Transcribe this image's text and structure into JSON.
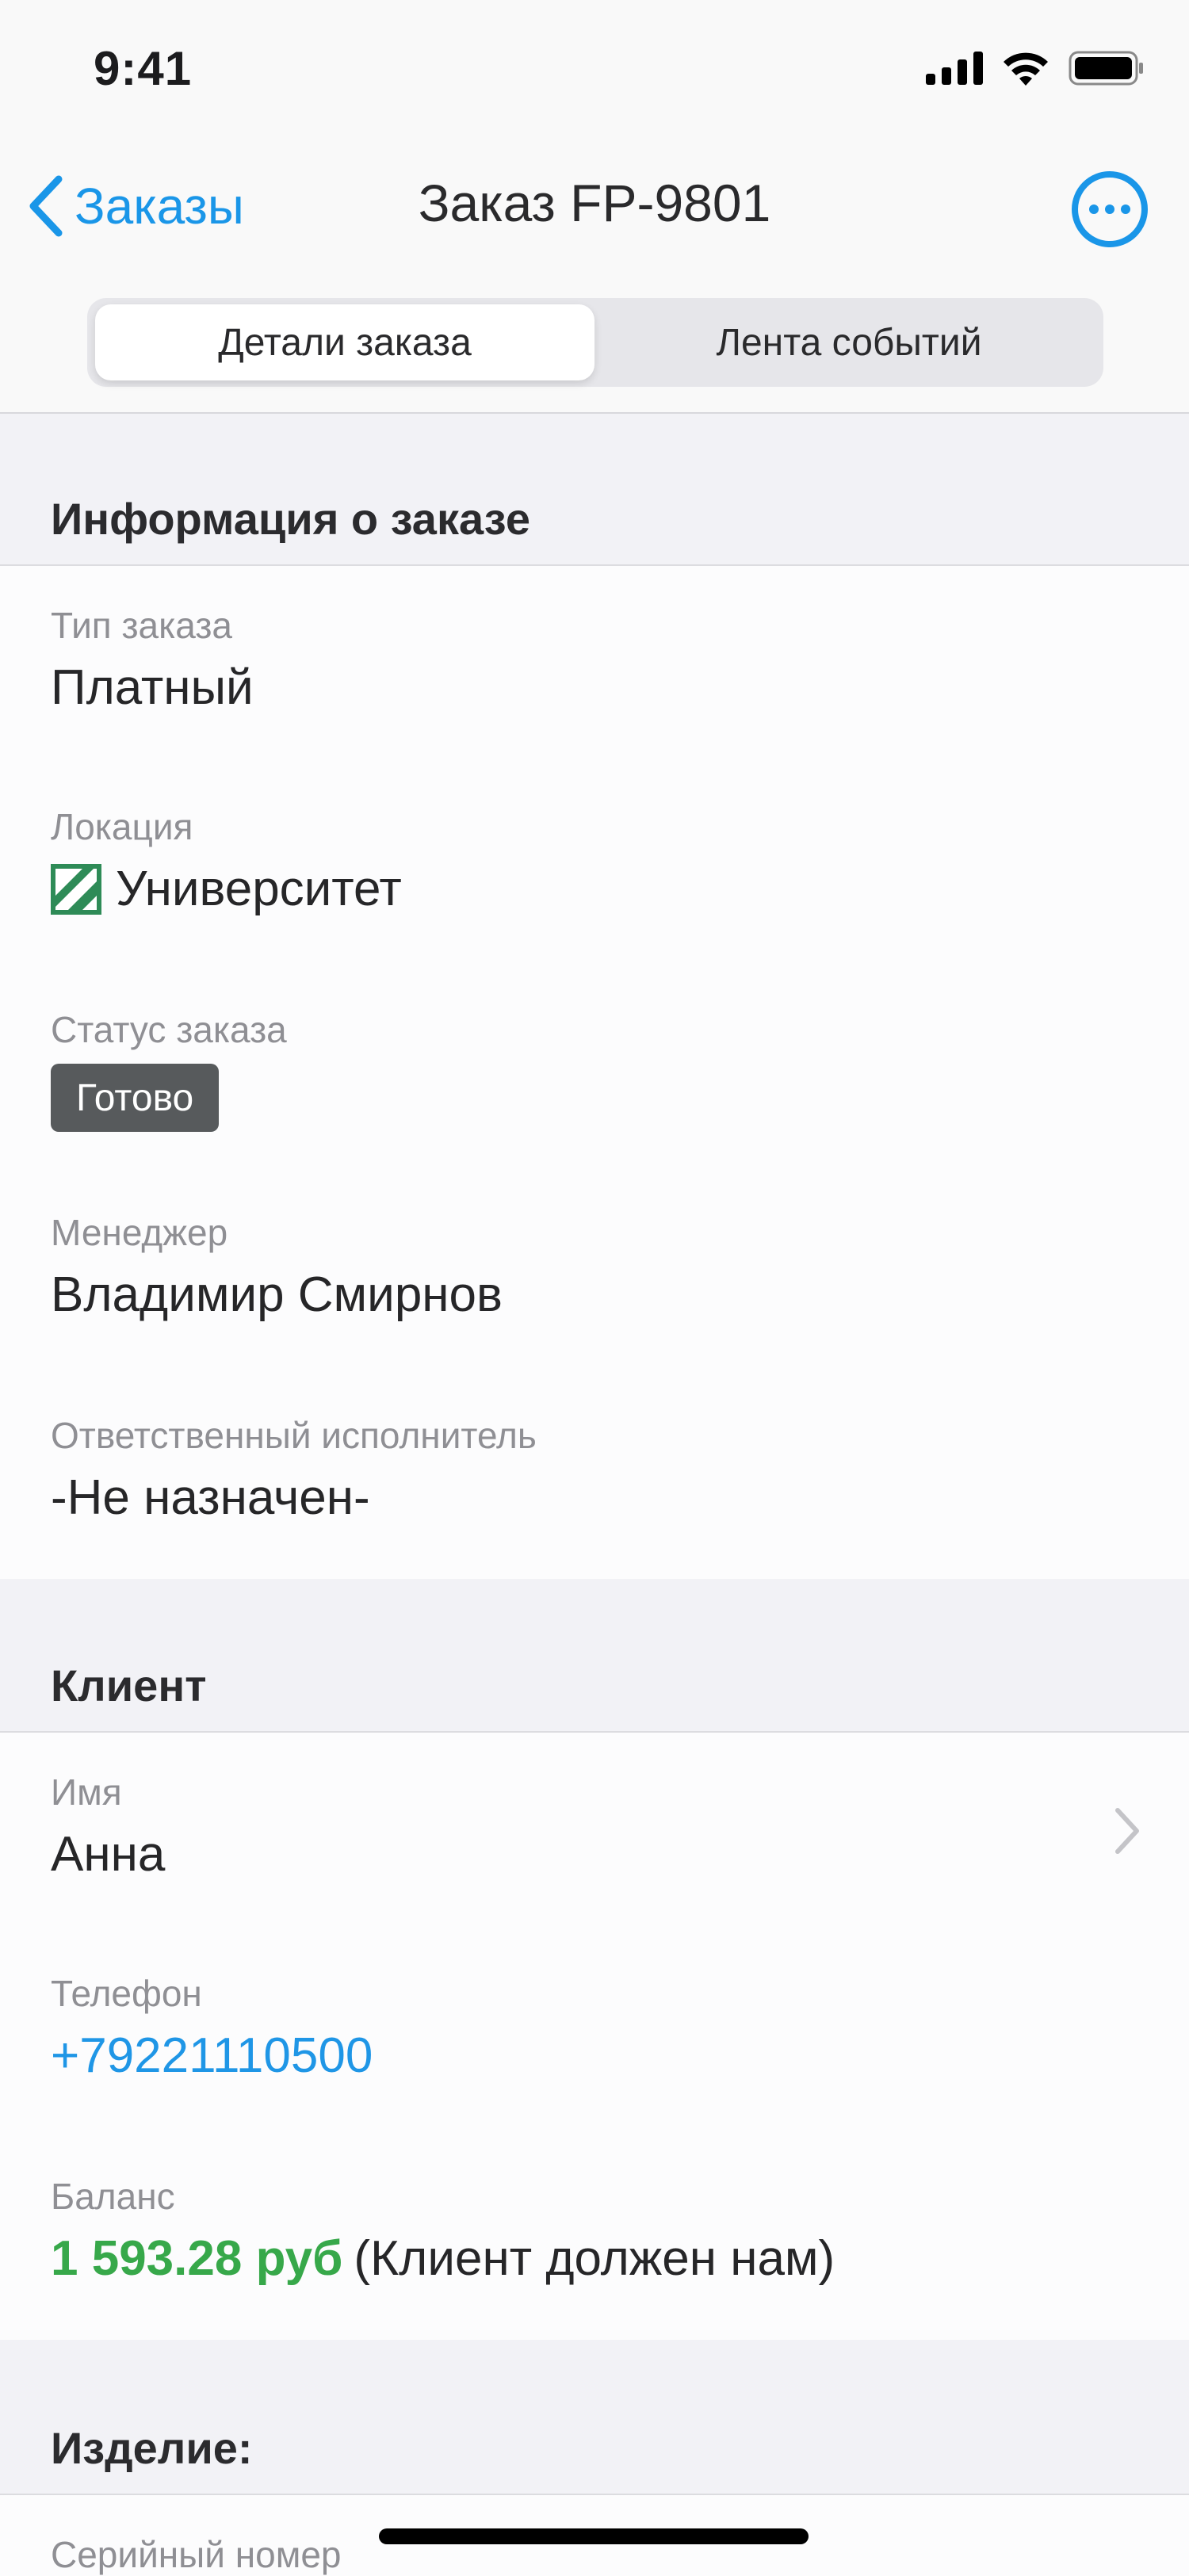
{
  "status_bar": {
    "time": "9:41"
  },
  "nav": {
    "back_label": "Заказы",
    "title": "Заказ FP-9801"
  },
  "tabs": {
    "details": "Детали заказа",
    "feed": "Лента событий"
  },
  "order_info": {
    "header": "Информация о заказе",
    "type_label": "Тип заказа",
    "type_value": "Платный",
    "location_label": "Локация",
    "location_value": "Университет",
    "status_label": "Статус заказа",
    "status_value": "Готово",
    "manager_label": "Менеджер",
    "manager_value": "Владимир Смирнов",
    "assignee_label": "Ответственный исполнитель",
    "assignee_value": "-Не назначен-"
  },
  "client": {
    "header": "Клиент",
    "name_label": "Имя",
    "name_value": "Анна",
    "phone_label": "Телефон",
    "phone_value": "+79221110500",
    "balance_label": "Баланс",
    "balance_amount": "1 593.28 руб",
    "balance_note": "(Клиент должен нам)"
  },
  "product": {
    "header": "Изделие:",
    "serial_label": "Серийный номер"
  },
  "colors": {
    "accent": "#1a96e8",
    "positive": "#37a84a",
    "status_badge": "#575a5c",
    "location_icon": "#2e8b57"
  },
  "icons": {
    "signal": "cellular-signal-icon",
    "wifi": "wifi-icon",
    "battery": "battery-icon",
    "back": "chevron-left-icon",
    "more": "ellipsis-circle-icon",
    "location": "striped-square-icon",
    "disclosure": "chevron-right-icon"
  }
}
